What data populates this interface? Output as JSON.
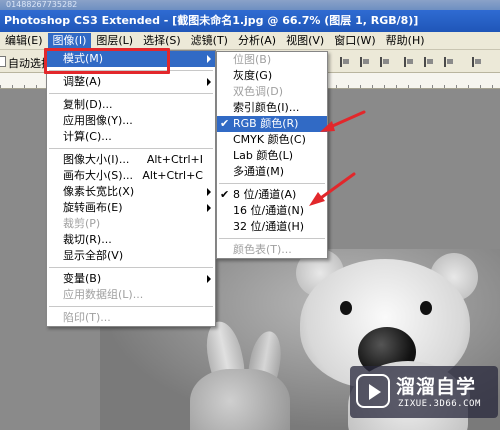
{
  "window": {
    "top_strip_text": "01488267735282",
    "title": "Photoshop CS3 Extended - [截图未命名1.jpg @ 66.7% (图层 1, RGB/8)]"
  },
  "menubar": [
    {
      "label": "编辑(E)"
    },
    {
      "label": "图像(I)"
    },
    {
      "label": "图层(L)"
    },
    {
      "label": "选择(S)"
    },
    {
      "label": "滤镜(T)"
    },
    {
      "label": "分析(A)"
    },
    {
      "label": "视图(V)"
    },
    {
      "label": "窗口(W)"
    },
    {
      "label": "帮助(H)"
    }
  ],
  "options_bar": {
    "auto_select_label": "自动选择"
  },
  "image_menu": [
    {
      "label": "模式(M)",
      "submenu": true,
      "highlighted": true
    },
    {
      "separator": true
    },
    {
      "label": "调整(A)",
      "submenu": true
    },
    {
      "separator": true
    },
    {
      "label": "复制(D)..."
    },
    {
      "label": "应用图像(Y)..."
    },
    {
      "label": "计算(C)..."
    },
    {
      "separator": true
    },
    {
      "label": "图像大小(I)...",
      "shortcut": "Alt+Ctrl+I"
    },
    {
      "label": "画布大小(S)...",
      "shortcut": "Alt+Ctrl+C"
    },
    {
      "label": "像素长宽比(X)",
      "submenu": true
    },
    {
      "label": "旋转画布(E)",
      "submenu": true
    },
    {
      "label": "裁剪(P)",
      "disabled": true
    },
    {
      "label": "裁切(R)..."
    },
    {
      "label": "显示全部(V)"
    },
    {
      "separator": true
    },
    {
      "label": "变量(B)",
      "submenu": true
    },
    {
      "label": "应用数据组(L)...",
      "disabled": true
    },
    {
      "separator": true
    },
    {
      "label": "陷印(T)...",
      "disabled": true
    }
  ],
  "mode_menu": [
    {
      "label": "位图(B)",
      "disabled": true
    },
    {
      "label": "灰度(G)"
    },
    {
      "label": "双色调(D)",
      "disabled": true
    },
    {
      "label": "索引颜色(I)..."
    },
    {
      "label": "RGB 颜色(R)",
      "checked": true,
      "highlighted": true
    },
    {
      "label": "CMYK 颜色(C)"
    },
    {
      "label": "Lab 颜色(L)"
    },
    {
      "label": "多通道(M)"
    },
    {
      "separator": true
    },
    {
      "label": "8 位/通道(A)",
      "checked": true
    },
    {
      "label": "16 位/通道(N)"
    },
    {
      "label": "32 位/通道(H)"
    },
    {
      "separator": true
    },
    {
      "label": "颜色表(T)...",
      "disabled": true
    }
  ],
  "watermark": {
    "name": "溜溜自学",
    "url": "ZIXUE.3D66.COM"
  },
  "icons": {
    "checkmark": "✔",
    "submenu_arrow": "arrow-right-icon",
    "logo": "play-logo-icon"
  },
  "colors": {
    "title_bar": "#1f56b8",
    "highlight": "#316ac5",
    "annotation_red": "#e2272b",
    "menu_bg": "#ffffff",
    "chrome_bg": "#ece9d8"
  }
}
